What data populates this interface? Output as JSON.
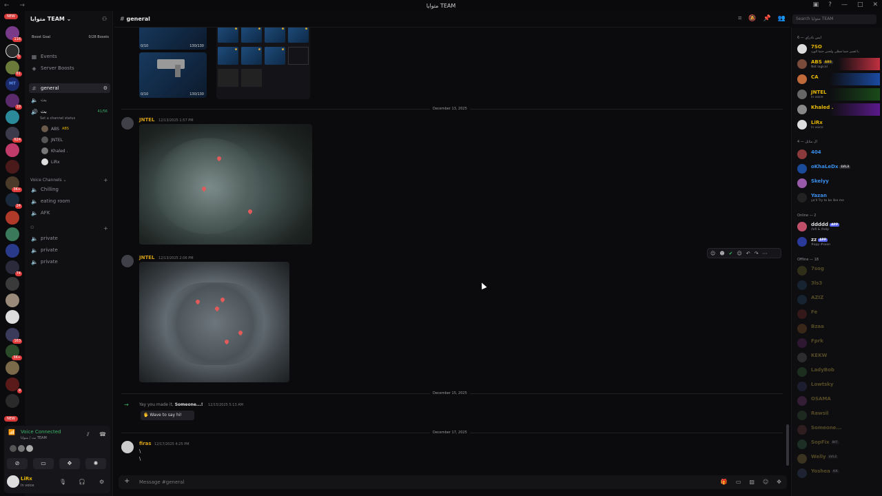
{
  "window": {
    "title": "متوايا TEAM",
    "nav": "← →"
  },
  "rail": {
    "new_label": "NEW",
    "new_label_bottom": "NEW",
    "badges": [
      "116",
      "5",
      "61",
      "19",
      "624",
      "3K+",
      "24",
      "74",
      "163",
      "3K+",
      "9",
      "17"
    ]
  },
  "sidebar": {
    "server_name": "متوايا TEAM",
    "boost_goal": "Boost Goal",
    "boost_count": "0/28 Boosts",
    "events": "Events",
    "server_boosts": "Server Boosts",
    "text_channels": [
      {
        "name": "general"
      },
      {
        "name": "بث"
      }
    ],
    "voice_channel": {
      "name": "بث",
      "count": "41/56",
      "status": "Set a channel status"
    },
    "voice_users": [
      "ABS",
      "JNTEL",
      "Khaled .",
      "LiRx"
    ],
    "voice_users_tag": "ABS",
    "voice_category": "Voice Channels",
    "voice_channels": [
      "Chilling",
      "eating room",
      "AFK"
    ],
    "private_category": "",
    "private_channels": [
      "private",
      "private",
      "private"
    ]
  },
  "voice_panel": {
    "status": "Voice Connected",
    "location": "بث / متوايا TEAM",
    "user": "LiRx",
    "user_status": "In voice"
  },
  "header": {
    "channel": "general",
    "search_placeholder": "Search متوايا TEAM"
  },
  "chat": {
    "attachment_counts": [
      "0/10",
      "130/130",
      "0/10",
      "130/130"
    ],
    "dates": [
      "December 13, 2025",
      "December 15, 2025",
      "December 17, 2025"
    ],
    "messages": [
      {
        "author": "JNTEL",
        "time": "12/13/2025 1:57 PM",
        "color": "#d4a017"
      },
      {
        "author": "JNTEL",
        "time": "12/13/2025 2:06 PM",
        "color": "#d4a017"
      }
    ],
    "system": {
      "text": "Yay you made it,",
      "who": "Someone...!",
      "time": "12/15/2025 5:13 AM",
      "wave": "Wave to say hi!"
    },
    "last": {
      "author": "firas",
      "time": "12/17/2025 4:25 PM",
      "lines": [
        "\\",
        "\\"
      ],
      "color": "#d4a017"
    },
    "input_placeholder": "Message #general"
  },
  "members": {
    "group1": "ايس بادراي — 6",
    "group1_members": [
      {
        "name": "7SO",
        "status": "يا لعصر حتما فطلي ولحس حتما الورد",
        "color": "#e6b800"
      },
      {
        "name": "ABS",
        "status": "Not logical",
        "color": "#e6b800",
        "tag": "ABS"
      },
      {
        "name": "CA",
        "status": "",
        "color": "#e6b800"
      },
      {
        "name": "JNTEL",
        "status": "In voice",
        "color": "#e6b800"
      },
      {
        "name": "Khaled .",
        "status": "",
        "color": "#e6b800"
      },
      {
        "name": "LiRx",
        "status": "In voice",
        "color": "#e6b800"
      }
    ],
    "group2": "ال متايل — 4",
    "group2_members": [
      {
        "name": "404",
        "status": "",
        "color": "#3a8eea"
      },
      {
        "name": "oKhaLeDx",
        "status": "",
        "color": "#3a8eea",
        "tag": "LVL3"
      },
      {
        "name": "Skelyy",
        "status": "",
        "color": "#3a8eea"
      },
      {
        "name": "Yazan",
        "status": "ya'll Try to be like me",
        "color": "#3a8eea"
      }
    ],
    "online": "Online — 2",
    "online_members": [
      {
        "name": "ddddd",
        "status": "/lofi & /help",
        "tag": "APP"
      },
      {
        "name": "zz",
        "status": "#app #soon",
        "tag": "APP"
      }
    ],
    "offline": "Offline — 18",
    "offline_members": [
      "7sog",
      "3ls3",
      "AZIZ",
      "Fe",
      "Bzaa",
      "Fprk",
      "KEKW",
      "LadyBob",
      "Lowtsky",
      "OSAMA",
      "Rawsil",
      "Someone...",
      "SopFix",
      "Welly",
      "Yoshea"
    ],
    "offline_tags": {
      "SopFix": "BIT",
      "Welly": "LVL2",
      "Yoshea": "KK"
    }
  }
}
